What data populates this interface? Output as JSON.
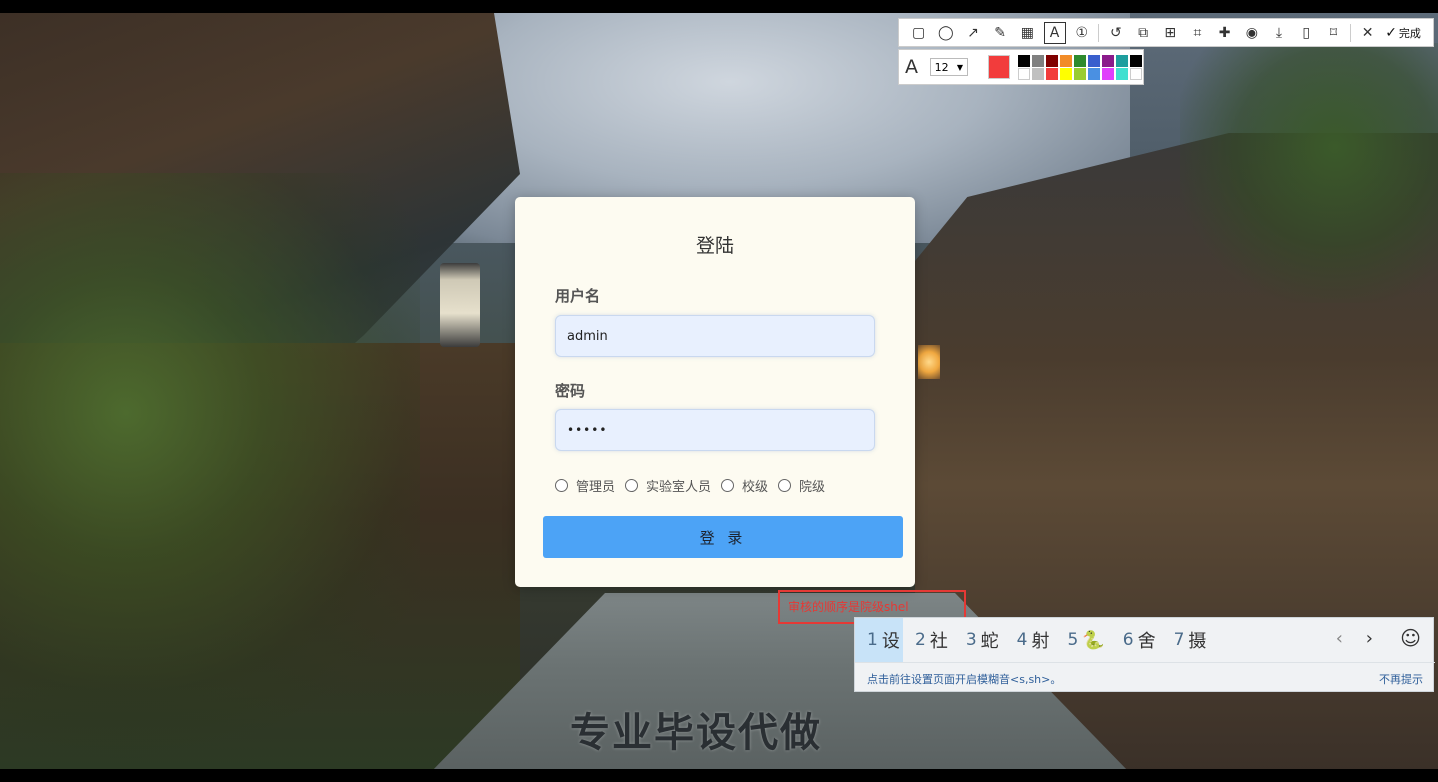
{
  "login": {
    "title": "登陆",
    "username_label": "用户名",
    "username_value": "admin",
    "password_label": "密码",
    "password_value": "•••••",
    "roles": [
      "管理员",
      "实验室人员",
      "校级",
      "院级"
    ],
    "submit_label": "登 录"
  },
  "toolbar": {
    "done_label": "完成",
    "font_size": "12",
    "current_color": "#f23c3c",
    "palette": [
      "#000000",
      "#808080",
      "#800000",
      "#f28c28",
      "#2e8b2e",
      "#3a5fcd",
      "#8b1a8b",
      "#1e9e9e",
      "#000000",
      "#ffffff",
      "#c0c0c0",
      "#f23c3c",
      "#ffff00",
      "#9acd32",
      "#4a90e2",
      "#e040fb",
      "#40e0d0",
      "#ffffff"
    ]
  },
  "annotation": {
    "text": "审核的顺序是院级shel"
  },
  "ime": {
    "candidates": [
      "设",
      "社",
      "蛇",
      "射",
      "🐍",
      "舍",
      "摄"
    ],
    "hint": "点击前往设置页面开启模糊音<s,sh>。",
    "dismiss": "不再提示"
  },
  "watermark": "专业毕设代做"
}
